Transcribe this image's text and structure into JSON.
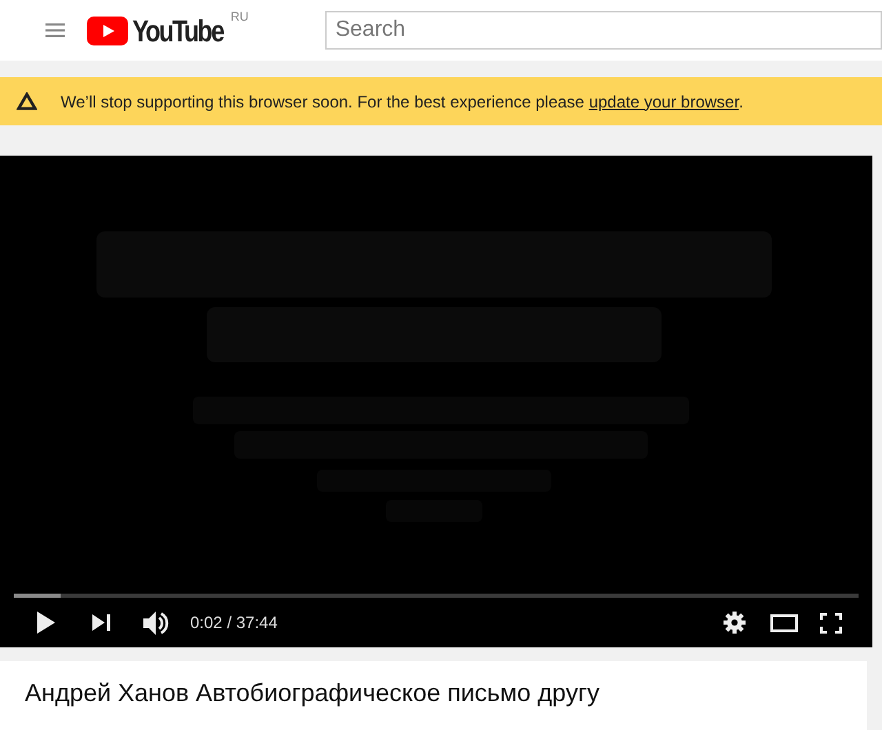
{
  "header": {
    "logo": "YouTube",
    "region": "RU",
    "search": {
      "placeholder": "Search"
    }
  },
  "banner": {
    "text": "We’ll stop supporting this browser soon. For the best experience please ",
    "link": "update your browser",
    "end": "."
  },
  "player": {
    "kind": "picture",
    "progress": {
      "level": 0.055
    },
    "time": "0:02 / 37:44"
  },
  "video_title": "Андрей Ханов Автобиографическое письмо другу"
}
